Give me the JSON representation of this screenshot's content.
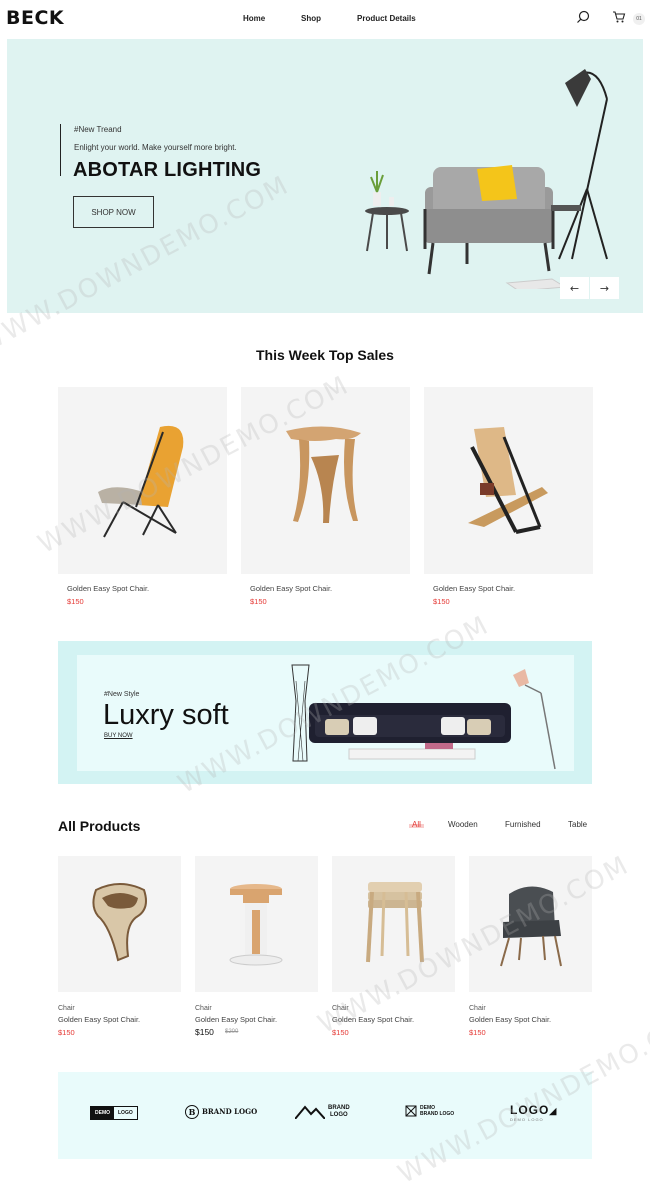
{
  "header": {
    "logo": "BECK",
    "nav": [
      "Home",
      "Shop",
      "Product Details"
    ],
    "cart_count": "01"
  },
  "hero": {
    "tag": "#New Treand",
    "subtitle": "Enlight your world. Make yourself more bright.",
    "title": "ABOTAR LIGHTING",
    "button": "SHOP NOW",
    "prev_icon": "←",
    "next_icon": "→"
  },
  "top_sales": {
    "title": "This Week Top Sales",
    "items": [
      {
        "name": "Golden Easy Spot Chair.",
        "price": "$150"
      },
      {
        "name": "Golden Easy Spot Chair.",
        "price": "$150"
      },
      {
        "name": "Golden Easy Spot Chair.",
        "price": "$150"
      }
    ]
  },
  "banner": {
    "tag": "#New Style",
    "title": "Luxry soft",
    "link": "BUY NOW"
  },
  "all_products": {
    "title": "All Products",
    "filters": [
      "All",
      "Wooden",
      "Furnished",
      "Table"
    ],
    "items": [
      {
        "category": "Chair",
        "name": "Golden Easy Spot Chair.",
        "price": "$150"
      },
      {
        "category": "Chair",
        "name": "Golden Easy Spot Chair.",
        "price": "$150",
        "old_price": "$200"
      },
      {
        "category": "Chair",
        "name": "Golden Easy Spot Chair.",
        "price": "$150"
      },
      {
        "category": "Chair",
        "name": "Golden Easy Spot Chair.",
        "price": "$150"
      }
    ]
  },
  "brands": {
    "b1_left": "DEMO",
    "b1_right": "LOGO",
    "b2": "BRAND LOGO",
    "b3_line1": "BRAND",
    "b3_line2": "LOGO",
    "b4_line1": "DEMO",
    "b4_line2": "BRAND LOGO",
    "b5": "LOGO",
    "b5_sub": "DEMO LOGO"
  },
  "watermark": "WWW.DOWNDEMO.COM",
  "colors": {
    "accent": "#e53935",
    "hero_bg": "#dff3f1",
    "banner_bg": "#d3f3f3"
  }
}
